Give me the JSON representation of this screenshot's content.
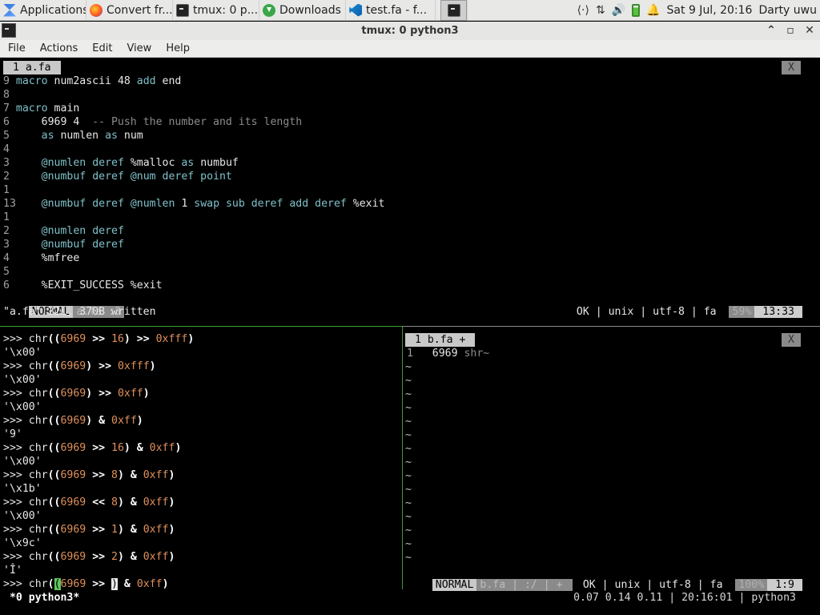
{
  "taskbar": {
    "items": [
      {
        "label": "Applications ☰",
        "icon": "applications-icon"
      },
      {
        "label": "Convert fr...",
        "icon": "firefox-icon"
      },
      {
        "label": "tmux: 0 p...",
        "icon": "terminal-icon"
      },
      {
        "label": "Downloads",
        "icon": "download-icon"
      },
      {
        "label": "test.fa - f...",
        "icon": "vscode-icon"
      },
      {
        "label": "",
        "icon": "terminal-icon"
      }
    ],
    "tray": {
      "network_glyph": "⟨·⟩",
      "transfer_glyph": "⇅",
      "volume_glyph": "🔊",
      "bell_glyph": "🔔",
      "clock": "Sat  9 Jul, 20:16",
      "user": "Darty uwu"
    }
  },
  "window": {
    "title": "tmux: 0 python3",
    "controls": {
      "minimize": "⌃",
      "maximize": "▫",
      "close": "✕"
    }
  },
  "menubar": [
    "File",
    "Actions",
    "Edit",
    "View",
    "Help"
  ],
  "top_pane": {
    "tab_label": " 1 a.fa ",
    "close_label": "X",
    "code_lines": [
      [
        {
          "t": "9 ",
          "c": "ln"
        },
        {
          "t": "macro ",
          "c": "kw"
        },
        {
          "t": "num2ascii ",
          "c": "str"
        },
        {
          "t": "48 ",
          "c": "str"
        },
        {
          "t": "add ",
          "c": "kw"
        },
        {
          "t": "end",
          "c": "str"
        }
      ],
      [
        {
          "t": "8",
          "c": "ln"
        }
      ],
      [
        {
          "t": "7 ",
          "c": "ln"
        },
        {
          "t": "macro ",
          "c": "kw"
        },
        {
          "t": "main",
          "c": "str"
        }
      ],
      [
        {
          "t": "6 ",
          "c": "ln"
        },
        {
          "t": "    6969 4  ",
          "c": "str"
        },
        {
          "t": "-- Push the number and its length",
          "c": "cm"
        }
      ],
      [
        {
          "t": "5 ",
          "c": "ln"
        },
        {
          "t": "    ",
          "c": "str"
        },
        {
          "t": "as ",
          "c": "kw"
        },
        {
          "t": "numlen ",
          "c": "str"
        },
        {
          "t": "as ",
          "c": "kw"
        },
        {
          "t": "num",
          "c": "str"
        }
      ],
      [
        {
          "t": "4",
          "c": "ln"
        }
      ],
      [
        {
          "t": "3 ",
          "c": "ln"
        },
        {
          "t": "    ",
          "c": "str"
        },
        {
          "t": "@numlen ",
          "c": "kw"
        },
        {
          "t": "deref ",
          "c": "kw"
        },
        {
          "t": "%malloc ",
          "c": "str"
        },
        {
          "t": "as ",
          "c": "kw"
        },
        {
          "t": "numbuf",
          "c": "str"
        }
      ],
      [
        {
          "t": "2 ",
          "c": "ln"
        },
        {
          "t": "    ",
          "c": "str"
        },
        {
          "t": "@numbuf ",
          "c": "kw"
        },
        {
          "t": "deref ",
          "c": "kw"
        },
        {
          "t": "@num ",
          "c": "kw"
        },
        {
          "t": "deref ",
          "c": "kw"
        },
        {
          "t": "point",
          "c": "kw"
        }
      ],
      [
        {
          "t": "1",
          "c": "ln"
        }
      ],
      [
        {
          "t": "13",
          "c": "ln"
        },
        {
          "t": "    ",
          "c": "str"
        },
        {
          "t": "@numbuf ",
          "c": "kw"
        },
        {
          "t": "deref ",
          "c": "kw"
        },
        {
          "t": "@numlen ",
          "c": "kw"
        },
        {
          "t": "1 ",
          "c": "str"
        },
        {
          "t": "swap ",
          "c": "kw"
        },
        {
          "t": "sub ",
          "c": "kw"
        },
        {
          "t": "deref ",
          "c": "kw"
        },
        {
          "t": "add ",
          "c": "kw"
        },
        {
          "t": "deref ",
          "c": "kw"
        },
        {
          "t": "%exit",
          "c": "str"
        }
      ],
      [
        {
          "t": "1",
          "c": "ln"
        }
      ],
      [
        {
          "t": "2 ",
          "c": "ln"
        },
        {
          "t": "    ",
          "c": "str"
        },
        {
          "t": "@numlen ",
          "c": "kw"
        },
        {
          "t": "deref",
          "c": "kw"
        }
      ],
      [
        {
          "t": "3 ",
          "c": "ln"
        },
        {
          "t": "    ",
          "c": "str"
        },
        {
          "t": "@numbuf ",
          "c": "kw"
        },
        {
          "t": "deref",
          "c": "kw"
        }
      ],
      [
        {
          "t": "4 ",
          "c": "ln"
        },
        {
          "t": "    ",
          "c": "str"
        },
        {
          "t": "%mfree",
          "c": "str"
        }
      ],
      [
        {
          "t": "5",
          "c": "ln"
        }
      ],
      [
        {
          "t": "6 ",
          "c": "ln"
        },
        {
          "t": "    ",
          "c": "str"
        },
        {
          "t": "%EXIT_SUCCESS %exit",
          "c": "str"
        }
      ]
    ],
    "status": {
      "mode": "NORMAL",
      "file": "a.fa",
      "extra": " :3",
      "info": "OK | unix | utf-8 | fa",
      "percent": "59%",
      "pos": "13:33"
    },
    "message": "\"a.fa\" 22L, 370B written"
  },
  "python_pane": {
    "lines": [
      [
        {
          "t": ">>> ",
          "c": "str"
        },
        {
          "t": "chr",
          "c": "str"
        },
        {
          "t": "((",
          "c": "op"
        },
        {
          "t": "6969",
          "c": "num"
        },
        {
          "t": " >> ",
          "c": "op"
        },
        {
          "t": "16",
          "c": "num"
        },
        {
          "t": ") >> ",
          "c": "op"
        },
        {
          "t": "0xfff",
          "c": "num"
        },
        {
          "t": ")",
          "c": "op"
        }
      ],
      [
        {
          "t": "'\\x00'",
          "c": "str"
        }
      ],
      [
        {
          "t": ">>> ",
          "c": "str"
        },
        {
          "t": "chr",
          "c": "str"
        },
        {
          "t": "((",
          "c": "op"
        },
        {
          "t": "6969",
          "c": "num"
        },
        {
          "t": ") >> ",
          "c": "op"
        },
        {
          "t": "0xfff",
          "c": "num"
        },
        {
          "t": ")",
          "c": "op"
        }
      ],
      [
        {
          "t": "'\\x00'",
          "c": "str"
        }
      ],
      [
        {
          "t": ">>> ",
          "c": "str"
        },
        {
          "t": "chr",
          "c": "str"
        },
        {
          "t": "((",
          "c": "op"
        },
        {
          "t": "6969",
          "c": "num"
        },
        {
          "t": ") >> ",
          "c": "op"
        },
        {
          "t": "0xff",
          "c": "num"
        },
        {
          "t": ")",
          "c": "op"
        }
      ],
      [
        {
          "t": "'\\x00'",
          "c": "str"
        }
      ],
      [
        {
          "t": ">>> ",
          "c": "str"
        },
        {
          "t": "chr",
          "c": "str"
        },
        {
          "t": "((",
          "c": "op"
        },
        {
          "t": "6969",
          "c": "num"
        },
        {
          "t": ") & ",
          "c": "op"
        },
        {
          "t": "0xff",
          "c": "num"
        },
        {
          "t": ")",
          "c": "op"
        }
      ],
      [
        {
          "t": "'9'",
          "c": "str"
        }
      ],
      [
        {
          "t": ">>> ",
          "c": "str"
        },
        {
          "t": "chr",
          "c": "str"
        },
        {
          "t": "((",
          "c": "op"
        },
        {
          "t": "6969",
          "c": "num"
        },
        {
          "t": " >> ",
          "c": "op"
        },
        {
          "t": "16",
          "c": "num"
        },
        {
          "t": ") & ",
          "c": "op"
        },
        {
          "t": "0xff",
          "c": "num"
        },
        {
          "t": ")",
          "c": "op"
        }
      ],
      [
        {
          "t": "'\\x00'",
          "c": "str"
        }
      ],
      [
        {
          "t": ">>> ",
          "c": "str"
        },
        {
          "t": "chr",
          "c": "str"
        },
        {
          "t": "((",
          "c": "op"
        },
        {
          "t": "6969",
          "c": "num"
        },
        {
          "t": " >> ",
          "c": "op"
        },
        {
          "t": "8",
          "c": "num"
        },
        {
          "t": ") & ",
          "c": "op"
        },
        {
          "t": "0xff",
          "c": "num"
        },
        {
          "t": ")",
          "c": "op"
        }
      ],
      [
        {
          "t": "'\\x1b'",
          "c": "str"
        }
      ],
      [
        {
          "t": ">>> ",
          "c": "str"
        },
        {
          "t": "chr",
          "c": "str"
        },
        {
          "t": "((",
          "c": "op"
        },
        {
          "t": "6969",
          "c": "num"
        },
        {
          "t": " << ",
          "c": "op"
        },
        {
          "t": "8",
          "c": "num"
        },
        {
          "t": ") & ",
          "c": "op"
        },
        {
          "t": "0xff",
          "c": "num"
        },
        {
          "t": ")",
          "c": "op"
        }
      ],
      [
        {
          "t": "'\\x00'",
          "c": "str"
        }
      ],
      [
        {
          "t": ">>> ",
          "c": "str"
        },
        {
          "t": "chr",
          "c": "str"
        },
        {
          "t": "((",
          "c": "op"
        },
        {
          "t": "6969",
          "c": "num"
        },
        {
          "t": " >> ",
          "c": "op"
        },
        {
          "t": "1",
          "c": "num"
        },
        {
          "t": ") & ",
          "c": "op"
        },
        {
          "t": "0xff",
          "c": "num"
        },
        {
          "t": ")",
          "c": "op"
        }
      ],
      [
        {
          "t": "'\\x9c'",
          "c": "str"
        }
      ],
      [
        {
          "t": ">>> ",
          "c": "str"
        },
        {
          "t": "chr",
          "c": "str"
        },
        {
          "t": "((",
          "c": "op"
        },
        {
          "t": "6969",
          "c": "num"
        },
        {
          "t": " >> ",
          "c": "op"
        },
        {
          "t": "2",
          "c": "num"
        },
        {
          "t": ") & ",
          "c": "op"
        },
        {
          "t": "0xff",
          "c": "num"
        },
        {
          "t": ")",
          "c": "op"
        }
      ],
      [
        {
          "t": "'Î'",
          "c": "str"
        }
      ],
      [
        {
          "t": ">>> ",
          "c": "str"
        },
        {
          "t": "chr",
          "c": "str"
        },
        {
          "t": "(",
          "c": "op"
        },
        {
          "t": "(",
          "c": "cursor-green"
        },
        {
          "t": "6969",
          "c": "num"
        },
        {
          "t": " >> ",
          "c": "op"
        },
        {
          "t": ")",
          "c": "cursor-white"
        },
        {
          "t": " & ",
          "c": "op"
        },
        {
          "t": "0xff",
          "c": "num"
        },
        {
          "t": ")",
          "c": "op"
        }
      ]
    ]
  },
  "bottom_right_pane": {
    "tab_label": " 1 b.fa + ",
    "close_label": "X",
    "line1": [
      {
        "t": "1   ",
        "c": "ln"
      },
      {
        "t": "6969 ",
        "c": "str"
      },
      {
        "t": "shr",
        "c": "cm"
      },
      {
        "t": "~",
        "c": "cm"
      }
    ],
    "tilde": "~",
    "tilde_count": 15,
    "status": {
      "mode": "NORMAL",
      "file": "b.fa",
      "extra": " | :/ | + ",
      "info": "OK | unix | utf-8 | fa",
      "percent": "100%",
      "pos": "1:9"
    }
  },
  "tmux_status": {
    "window": " *0 python3*",
    "right": "0.07 0.14 0.11 | 20:16:01 | python3"
  }
}
